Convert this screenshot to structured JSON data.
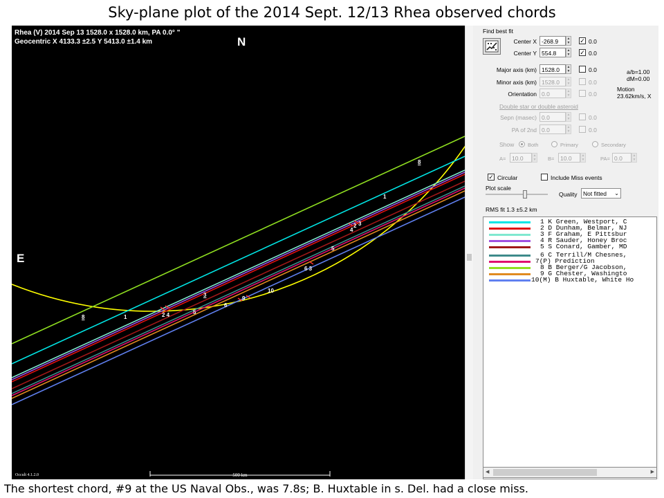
{
  "slide": {
    "title": "Sky-plane plot of the 2014 Sept. 12/13 Rhea observed chords",
    "caption": "The shortest chord, #9 at the US Naval Obs., was 7.8s; B. Huxtable in s. Del. had a close miss."
  },
  "plot": {
    "header_line1": "Rhea (V)  2014 Sep 13   1528.0 x 1528.0 km,  PA 0.0° \"",
    "header_line2": "Geocentric  X  4133.3 ±2.5  Y 5413.0 ±1.4 km",
    "north_label": "N",
    "east_label": "E",
    "version": "Occult 4.1.2.0",
    "scale_label": "500 km",
    "chord_labels": [
      {
        "text": "8",
        "underline": true
      },
      {
        "text": "1",
        "underline": false
      },
      {
        "text": "3",
        "underline": true
      },
      {
        "text": "2 4",
        "underline": false
      },
      {
        "text": "5",
        "underline": false
      },
      {
        "text": "6",
        "underline": false
      },
      {
        "text": "9",
        "underline": false
      },
      {
        "text": "10",
        "underline": false
      },
      {
        "text": "6 3",
        "underline": false
      },
      {
        "text": "5",
        "underline": false
      },
      {
        "text": "4",
        "underline": false
      },
      {
        "text": "2",
        "underline": false
      },
      {
        "text": "3",
        "underline": false
      },
      {
        "text": "1",
        "underline": false
      },
      {
        "text": "8",
        "underline": true
      }
    ],
    "colors": {
      "background": "#000000",
      "limb": "#ffff00",
      "chord_1": "#00e5e5",
      "chord_2": "#e01010",
      "chord_3": "#7fe8d0",
      "chord_4": "#a050e0",
      "chord_5": "#a01818",
      "chord_6": "#3d8a8a",
      "chord_7": "#e01070",
      "chord_8": "#90e020",
      "chord_9": "#e08a20",
      "chord_10": "#6080f0"
    }
  },
  "panel": {
    "find_best_fit_label": "Find best fit",
    "center_x": {
      "label": "Center X",
      "value": "-268.9",
      "check_label": "0.0",
      "checked": true
    },
    "center_y": {
      "label": "Center Y",
      "value": "554.8",
      "check_label": "0.0",
      "checked": true
    },
    "major_axis": {
      "label": "Major axis (km)",
      "value": "1528.0",
      "check_label": "0.0",
      "checked": false
    },
    "minor_axis": {
      "label": "Minor axis (km)",
      "value": "1528.0",
      "check_label": "0.0",
      "checked": false
    },
    "orientation": {
      "label": "Orientation",
      "value": "0.0",
      "check_label": "0.0",
      "checked": false
    },
    "stats": {
      "ab": "a/b=1.00",
      "dm": "dM=0.00",
      "motion_label": "Motion",
      "motion_value": "23.62km/s, X"
    },
    "double_star_link": "Double star  or  double asteroid",
    "sepn": {
      "label": "Sepn (masec)",
      "value": "0.0",
      "check_label": "0.0"
    },
    "pa_2nd": {
      "label": "PA of 2nd",
      "value": "0.0",
      "check_label": "0.0"
    },
    "show": {
      "label": "Show",
      "options": [
        "Both",
        "Primary",
        "Secondary"
      ]
    },
    "abpa": {
      "a_label": "A=",
      "a_value": "10.0",
      "b_label": "B=",
      "b_value": "10.0",
      "pa_label": "PA=",
      "pa_value": "0.0"
    },
    "circular": {
      "label": "Circular",
      "checked": true
    },
    "include_miss": {
      "label": "Include Miss events",
      "checked": false
    },
    "plot_scale_label": "Plot scale",
    "quality_label": "Quality",
    "quality_value": "Not fitted",
    "rms_fit": "RMS fit  1.3 ±5.2 km",
    "observers": [
      {
        "num": "1",
        "text": "K Green, Westport, C",
        "color": "#00e5e5"
      },
      {
        "num": "2",
        "text": "D Dunham, Belmar, NJ",
        "color": "#e01010"
      },
      {
        "num": "3",
        "text": "F Graham, E Pittsbur",
        "color": "#7fe8d0"
      },
      {
        "num": "4",
        "text": "R Sauder, Honey Broc",
        "color": "#a050e0"
      },
      {
        "num": "5",
        "text": "S Conard, Gamber, MD",
        "color": "#a01818"
      },
      {
        "num": "6",
        "text": "C Terrill/M Chesnes,",
        "color": "#3d8a8a"
      },
      {
        "num": "7(P)",
        "text": "Prediction",
        "color": "#e01070"
      },
      {
        "num": "8",
        "text": "B Berger/G Jacobson,",
        "color": "#90e020"
      },
      {
        "num": "9",
        "text": "G Chester, Washingto",
        "color": "#e08a20"
      },
      {
        "num": "10(M)",
        "text": "B Huxtable, White Ho",
        "color": "#6080f0"
      }
    ]
  }
}
